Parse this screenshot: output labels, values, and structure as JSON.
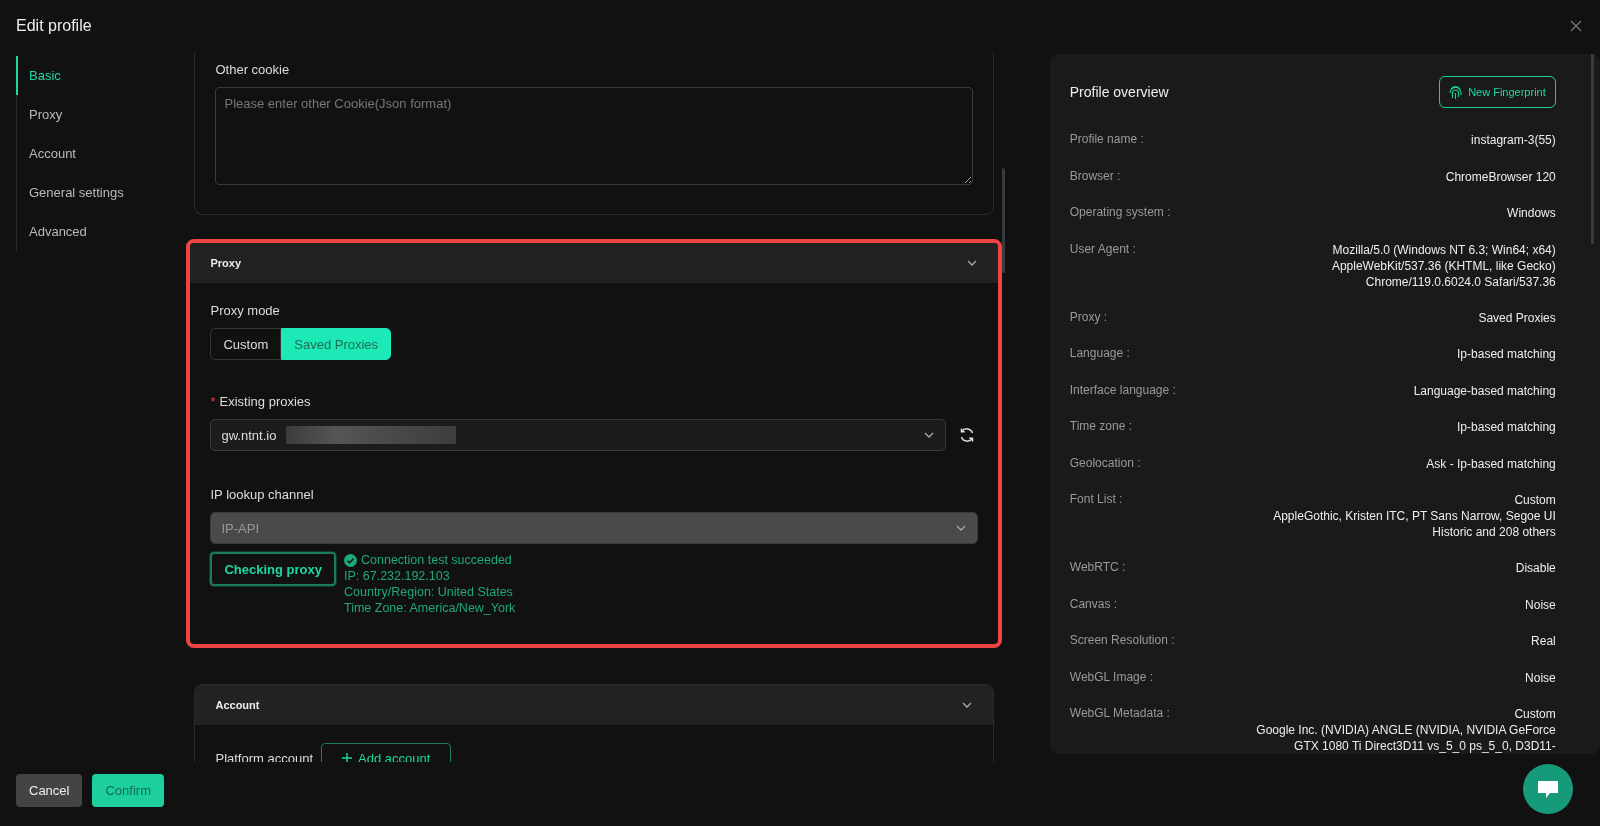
{
  "window": {
    "title": "Edit profile"
  },
  "sidebar": {
    "items": [
      {
        "label": "Basic",
        "selected": true
      },
      {
        "label": "Proxy",
        "selected": false
      },
      {
        "label": "Account",
        "selected": false
      },
      {
        "label": "General settings",
        "selected": false
      },
      {
        "label": "Advanced",
        "selected": false
      }
    ]
  },
  "cookie_section": {
    "label": "Other cookie",
    "placeholder": "Please enter other Cookie(Json format)"
  },
  "proxy_section": {
    "title": "Proxy",
    "highlighted": true,
    "expanded": true,
    "mode_label": "Proxy mode",
    "modes": [
      {
        "label": "Custom",
        "selected": false
      },
      {
        "label": "Saved Proxies",
        "selected": true
      }
    ],
    "existing_label": "Existing proxies",
    "required_mark": "*",
    "existing_value": "gw.ntnt.io",
    "lookup_label": "IP lookup channel",
    "lookup_value": "IP-API",
    "lookup_disabled": true,
    "check_button": "Checking proxy",
    "result": {
      "status": "Connection test succeeded",
      "lines": [
        "IP: 67.232.192.103",
        "Country/Region: United States",
        "Time Zone: America/New_York"
      ]
    }
  },
  "account_section": {
    "title": "Account",
    "expanded": true,
    "field_label": "Platform account",
    "add_button": "Add account"
  },
  "overview": {
    "title": "Profile overview",
    "button": "New Fingerprint",
    "rows": [
      {
        "label": "Profile name :",
        "lines": [
          "instagram-3(55)"
        ]
      },
      {
        "label": "Browser :",
        "lines": [
          "ChromeBrowser 120"
        ]
      },
      {
        "label": "Operating system :",
        "lines": [
          "Windows"
        ]
      },
      {
        "label": "User Agent :",
        "lines": [
          "Mozilla/5.0 (Windows NT 6.3; Win64; x64)",
          "AppleWebKit/537.36 (KHTML, like Gecko)",
          "Chrome/119.0.6024.0 Safari/537.36"
        ]
      },
      {
        "label": "Proxy :",
        "lines": [
          "Saved Proxies"
        ]
      },
      {
        "label": "Language :",
        "lines": [
          "Ip-based matching"
        ]
      },
      {
        "label": "Interface language :",
        "lines": [
          "Language-based matching"
        ]
      },
      {
        "label": "Time zone :",
        "lines": [
          "Ip-based matching"
        ]
      },
      {
        "label": "Geolocation :",
        "lines": [
          "Ask - Ip-based matching"
        ]
      },
      {
        "label": "Font List :",
        "lines": [
          "Custom",
          "AppleGothic, Kristen ITC, PT Sans Narrow, Segoe UI",
          "Historic and 208 others"
        ]
      },
      {
        "label": "WebRTC :",
        "lines": [
          "Disable"
        ]
      },
      {
        "label": "Canvas :",
        "lines": [
          "Noise"
        ]
      },
      {
        "label": "Screen Resolution :",
        "lines": [
          "Real"
        ]
      },
      {
        "label": "WebGL Image :",
        "lines": [
          "Noise"
        ]
      },
      {
        "label": "WebGL Metadata :",
        "lines": [
          "Custom",
          "Google Inc. (NVIDIA) ANGLE (NVIDIA, NVIDIA GeForce",
          "GTX 1080 Ti Direct3D11 vs_5_0 ps_5_0, D3D11-"
        ]
      }
    ]
  },
  "footer": {
    "buttons": [
      {
        "label": "Cancel",
        "kind": "secondary"
      },
      {
        "label": "Confirm",
        "kind": "primary"
      }
    ]
  }
}
